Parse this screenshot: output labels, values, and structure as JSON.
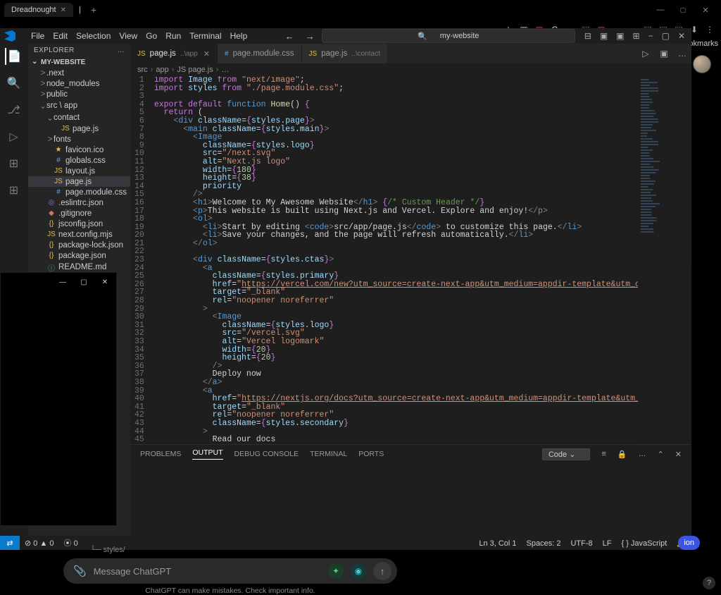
{
  "browser": {
    "tab_title": "Dreadnought",
    "bookmarks_label": "Bookmarks",
    "ext_icons": [
      "★",
      "▦",
      "▦",
      "G",
      "∞",
      "⬚",
      "▦",
      "⌁",
      "◑",
      "⬚",
      "⬚",
      "⬚",
      "⬇",
      "⋮"
    ],
    "ext_colors": [
      "#aaa",
      "#aaa",
      "#b83b3b",
      "#e2e2e2",
      "#d66c2c",
      "#aaa",
      "#b83b3b",
      "#5aa7dd",
      "#cfc7a8",
      "#aaa",
      "#aaa",
      "#aaa",
      "#aaa",
      "#aaa"
    ]
  },
  "menubar": {
    "items": [
      "File",
      "Edit",
      "Selection",
      "View",
      "Go",
      "Run",
      "Terminal",
      "Help"
    ],
    "search_label": "my-website",
    "search_icon": "🔍",
    "right_icons": [
      "⊟",
      "▣",
      "▣",
      "⊞",
      "−",
      "▢",
      "✕"
    ]
  },
  "activity": {
    "icons": [
      "📄",
      "🔍",
      "⎇",
      "▷",
      "⊞",
      "⊞"
    ]
  },
  "explorer": {
    "title": "EXPLORER",
    "dots": "…",
    "project": "MY-WEBSITE",
    "tree": [
      {
        "d": 1,
        "cv": ">",
        "name": ".next",
        "cls": ""
      },
      {
        "d": 1,
        "cv": ">",
        "name": "node_modules",
        "cls": ""
      },
      {
        "d": 1,
        "cv": ">",
        "name": "public",
        "cls": ""
      },
      {
        "d": 1,
        "cv": "⌄",
        "name": "src \\ app",
        "cls": ""
      },
      {
        "d": 2,
        "cv": "⌄",
        "name": "contact",
        "cls": ""
      },
      {
        "d": 3,
        "cv": "",
        "ic": "JS",
        "icls": "ic-js",
        "name": "page.js",
        "cls": ""
      },
      {
        "d": 2,
        "cv": ">",
        "name": "fonts",
        "cls": ""
      },
      {
        "d": 2,
        "cv": "",
        "ic": "★",
        "icls": "ic-ico",
        "name": "favicon.ico",
        "cls": ""
      },
      {
        "d": 2,
        "cv": "",
        "ic": "#",
        "icls": "ic-css",
        "name": "globals.css",
        "cls": ""
      },
      {
        "d": 2,
        "cv": "",
        "ic": "JS",
        "icls": "ic-js",
        "name": "layout.js",
        "cls": ""
      },
      {
        "d": 2,
        "cv": "",
        "ic": "JS",
        "icls": "ic-js",
        "name": "page.js",
        "cls": "sel"
      },
      {
        "d": 2,
        "cv": "",
        "ic": "#",
        "icls": "ic-css",
        "name": "page.module.css",
        "cls": ""
      },
      {
        "d": 1,
        "cv": "",
        "ic": "◎",
        "icls": "ic-eslint",
        "name": ".eslintrc.json",
        "cls": ""
      },
      {
        "d": 1,
        "cv": "",
        "ic": "◆",
        "icls": "ic-git",
        "name": ".gitignore",
        "cls": ""
      },
      {
        "d": 1,
        "cv": "",
        "ic": "{}",
        "icls": "ic-json",
        "name": "jsconfig.json",
        "cls": ""
      },
      {
        "d": 1,
        "cv": "",
        "ic": "JS",
        "icls": "ic-js",
        "name": "next.config.mjs",
        "cls": ""
      },
      {
        "d": 1,
        "cv": "",
        "ic": "{}",
        "icls": "ic-json",
        "name": "package-lock.json",
        "cls": ""
      },
      {
        "d": 1,
        "cv": "",
        "ic": "{}",
        "icls": "ic-json",
        "name": "package.json",
        "cls": ""
      },
      {
        "d": 1,
        "cv": "",
        "ic": "ⓘ",
        "icls": "ic-md",
        "name": "README.md",
        "cls": ""
      }
    ]
  },
  "editor_tabs": [
    {
      "ic": "JS",
      "icls": "ic-js",
      "name": "page.js",
      "suf": "..\\app",
      "close": "✕",
      "active": true
    },
    {
      "ic": "#",
      "icls": "ic-css",
      "name": "page.module.css",
      "suf": "",
      "close": "",
      "active": false
    },
    {
      "ic": "JS",
      "icls": "ic-js",
      "name": "page.js",
      "suf": "..\\contact",
      "close": "",
      "active": false
    }
  ],
  "tab_right_icons": [
    "▷",
    "▣",
    "…"
  ],
  "breadcrumb": [
    "src",
    "app",
    "JS page.js",
    "…"
  ],
  "code": [
    "<span class='kw'>import</span> <span class='id'>Image</span> <span class='kw'>from</span> <span class='str'>\"next/image\"</span>;",
    "<span class='kw'>import</span> <span class='id'>styles</span> <span class='kw'>from</span> <span class='str'>\"./page.module.css\"</span>;",
    "",
    "<span class='kw'>export</span> <span class='kw'>default</span> <span class='kw2'>function</span> <span class='fn'>Home</span>() <span class='brc'>{</span>",
    "  <span class='kw'>return</span> (",
    "    <span class='tagb'>&lt;</span><span class='tag'>div</span> <span class='attr'>className</span>=<span class='brc'>{</span><span class='obj'>styles</span>.<span class='prop'>page</span><span class='brc'>}</span><span class='tagb'>&gt;</span>",
    "      <span class='tagb'>&lt;</span><span class='tag'>main</span> <span class='attr'>className</span>=<span class='brc'>{</span><span class='obj'>styles</span>.<span class='prop'>main</span><span class='brc'>}</span><span class='tagb'>&gt;</span>",
    "        <span class='tagb'>&lt;</span><span class='tag'>Image</span>",
    "          <span class='attr'>className</span>=<span class='brc'>{</span><span class='obj'>styles</span>.<span class='prop'>logo</span><span class='brc'>}</span>",
    "          <span class='attr'>src</span>=<span class='str'>\"/next.svg\"</span>",
    "          <span class='attr'>alt</span>=<span class='str'>\"Next.js logo\"</span>",
    "          <span class='attr'>width</span>=<span class='brc'>{</span><span class='num'>180</span><span class='brc'>}</span>",
    "          <span class='attr'>height</span>=<span class='brc'>{</span><span class='num'>38</span><span class='brc'>}</span>",
    "          <span class='attr'>priority</span>",
    "        <span class='tagb'>/&gt;</span>",
    "        <span class='tagb'>&lt;</span><span class='tag'>h1</span><span class='tagb'>&gt;</span>Welcome to My Awesome Website<span class='tagb'>&lt;/</span><span class='tag'>h1</span><span class='tagb'>&gt;</span> <span class='brc'>{</span><span class='cmt'>/* Custom Header */</span><span class='brc'>}</span>",
    "        <span class='tagb'>&lt;</span><span class='tag'>p</span><span class='tagb'>&gt;</span>This website is built using Next.js and Vercel. Explore and enjoy!<span class='tagb'>&lt;/</span><span class='tag'>p</span><span class='tagb'>&gt;</span>",
    "        <span class='tagb'>&lt;</span><span class='tag'>ol</span><span class='tagb'>&gt;</span>",
    "          <span class='tagb'>&lt;</span><span class='tag'>li</span><span class='tagb'>&gt;</span>Start by editing <span class='tagb'>&lt;</span><span class='tag'>code</span><span class='tagb'>&gt;</span>src/app/page.js<span class='tagb'>&lt;/</span><span class='tag'>code</span><span class='tagb'>&gt;</span> to customize this page.<span class='tagb'>&lt;/</span><span class='tag'>li</span><span class='tagb'>&gt;</span>",
    "          <span class='tagb'>&lt;</span><span class='tag'>li</span><span class='tagb'>&gt;</span>Save your changes, and the page will refresh automatically.<span class='tagb'>&lt;/</span><span class='tag'>li</span><span class='tagb'>&gt;</span>",
    "        <span class='tagb'>&lt;/</span><span class='tag'>ol</span><span class='tagb'>&gt;</span>",
    "",
    "        <span class='tagb'>&lt;</span><span class='tag'>div</span> <span class='attr'>className</span>=<span class='brc'>{</span><span class='obj'>styles</span>.<span class='prop'>ctas</span><span class='brc'>}</span><span class='tagb'>&gt;</span>",
    "          <span class='tagb'>&lt;</span><span class='tag'>a</span>",
    "            <span class='attr'>className</span>=<span class='brc'>{</span><span class='obj'>styles</span>.<span class='prop'>primary</span><span class='brc'>}</span>",
    "            <span class='attr'>href</span>=<span class='str'>\"</span><span class='url'>https://vercel.com/new?utm_source=create-next-app&amp;utm_medium=appdir-template&amp;utm_campaign=create-next-app</span><span class='str'>\"</span>",
    "            <span class='attr'>target</span>=<span class='str'>\"_blank\"</span>",
    "            <span class='attr'>rel</span>=<span class='str'>\"noopener noreferrer\"</span>",
    "          <span class='tagb'>&gt;</span>",
    "            <span class='tagb'>&lt;</span><span class='tag'>Image</span>",
    "              <span class='attr'>className</span>=<span class='brc'>{</span><span class='obj'>styles</span>.<span class='prop'>logo</span><span class='brc'>}</span>",
    "              <span class='attr'>src</span>=<span class='str'>\"/vercel.svg\"</span>",
    "              <span class='attr'>alt</span>=<span class='str'>\"Vercel logomark\"</span>",
    "              <span class='attr'>width</span>=<span class='brc'>{</span><span class='num'>20</span><span class='brc'>}</span>",
    "              <span class='attr'>height</span>=<span class='brc'>{</span><span class='num'>20</span><span class='brc'>}</span>",
    "            <span class='tagb'>/&gt;</span>",
    "            Deploy now",
    "          <span class='tagb'>&lt;/</span><span class='tag'>a</span><span class='tagb'>&gt;</span>",
    "          <span class='tagb'>&lt;</span><span class='tag'>a</span>",
    "            <span class='attr'>href</span>=<span class='str'>\"</span><span class='url'>https://nextjs.org/docs?utm_source=create-next-app&amp;utm_medium=appdir-template&amp;utm_campaign=create-next-app</span><span class='str'>\"</span>",
    "            <span class='attr'>target</span>=<span class='str'>\"_blank\"</span>",
    "            <span class='attr'>rel</span>=<span class='str'>\"noopener noreferrer\"</span>",
    "            <span class='attr'>className</span>=<span class='brc'>{</span><span class='obj'>styles</span>.<span class='prop'>secondary</span><span class='brc'>}</span>",
    "          <span class='tagb'>&gt;</span>",
    "            Read our docs"
  ],
  "panel": {
    "tabs": [
      "PROBLEMS",
      "OUTPUT",
      "DEBUG CONSOLE",
      "TERMINAL",
      "PORTS"
    ],
    "active": 1,
    "selector": "Code",
    "right_icons": [
      "≡",
      "🔒",
      "…",
      "⌃",
      "✕"
    ]
  },
  "status": {
    "remote": "⇄",
    "left": [
      "⊘ 0 ▲ 0",
      "⦿ 0"
    ],
    "right": [
      "Ln 3, Col 1",
      "Spaces: 2",
      "UTF-8",
      "LF",
      "{ } JavaScript",
      "🔔"
    ]
  },
  "overlay": {
    "buttons": [
      "—",
      "▢",
      "✕"
    ]
  },
  "chat": {
    "path_prefix": "└─ ",
    "path": "styles/",
    "placeholder": "Message ChatGPT",
    "note": "ChatGPT can make mistakes. Check important info.",
    "send": "↑",
    "clip": "📎",
    "pill1": "✦",
    "pill2": "◉"
  },
  "ion_label": "ion",
  "help": "?"
}
